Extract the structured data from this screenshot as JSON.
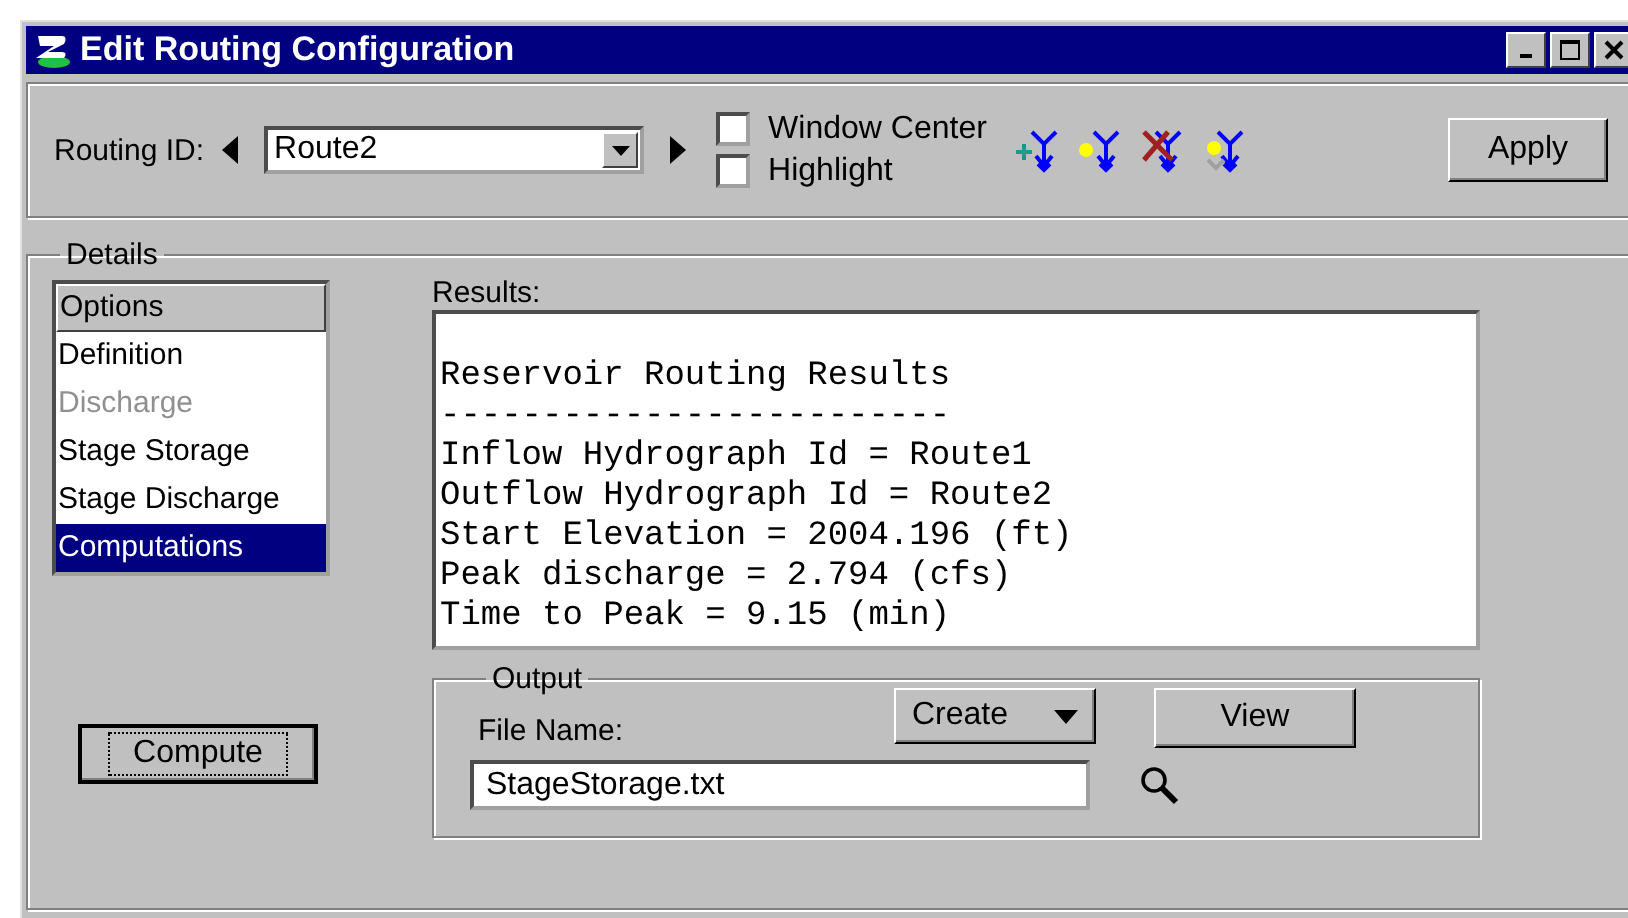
{
  "window": {
    "title": "Edit Routing Configuration"
  },
  "toolbar": {
    "routing_id_label": "Routing ID:",
    "routing_id": "Route2",
    "checkboxes": [
      {
        "label": "Window Center",
        "checked": false
      },
      {
        "label": "Highlight",
        "checked": false
      }
    ],
    "tools": [
      {
        "kind": "add"
      },
      {
        "kind": "star"
      },
      {
        "kind": "delete"
      },
      {
        "kind": "dim"
      }
    ],
    "apply_button": "Apply"
  },
  "details": {
    "title": "Details",
    "options": {
      "header": "Options",
      "items": [
        {
          "label": "Definition",
          "disabled": false,
          "selected": false
        },
        {
          "label": "Discharge",
          "disabled": true,
          "selected": false
        },
        {
          "label": "Stage Storage",
          "disabled": false,
          "selected": false
        },
        {
          "label": "Stage Discharge",
          "disabled": false,
          "selected": false
        },
        {
          "label": "Computations",
          "disabled": false,
          "selected": true
        }
      ]
    },
    "compute_button": "Compute",
    "results_label": "Results:",
    "results_lines": [
      "Reservoir Routing Results",
      "-------------------------",
      "Inflow Hydrograph Id = Route1",
      "Outflow Hydrograph Id = Route2",
      "Start Elevation = 2004.196 (ft)",
      "Peak discharge = 2.794 (cfs)",
      "Time to Peak = 9.15 (min)"
    ],
    "output": {
      "title": "Output",
      "create_button": "Create",
      "view_button": "View",
      "file_name_label": "File Name:",
      "file_name": "StageStorage.txt"
    }
  }
}
